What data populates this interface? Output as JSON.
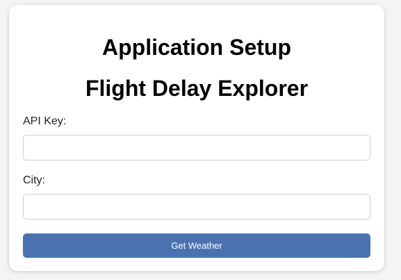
{
  "card": {
    "heading": "Application Setup",
    "app_title": "Flight Delay Explorer"
  },
  "form": {
    "api_key_label": "API Key:",
    "api_key_value": "",
    "city_label": "City:",
    "city_value": "",
    "submit_label": "Get Weather"
  },
  "colors": {
    "button_background": "#4a72b0",
    "button_text": "#ffffff",
    "card_background": "#ffffff",
    "page_background": "#f4f4f4"
  }
}
